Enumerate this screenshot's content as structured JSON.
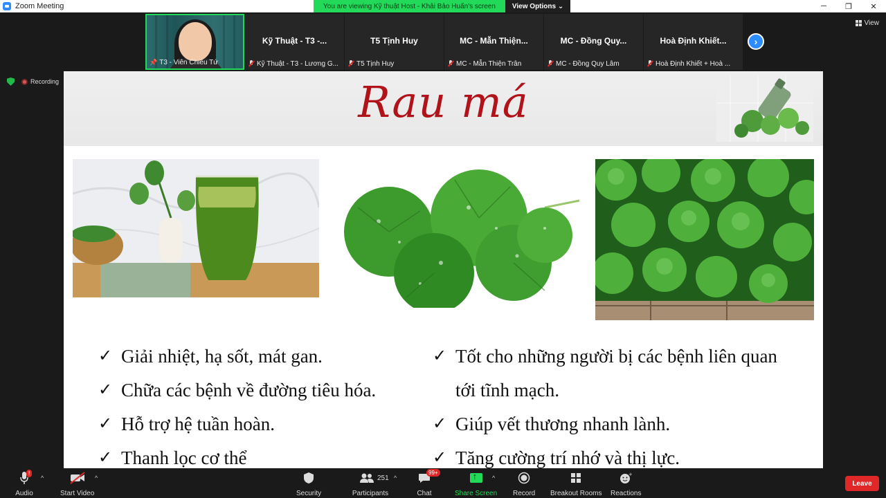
{
  "window": {
    "title": "Zoom Meeting",
    "controls": [
      "─",
      "❐",
      "✕"
    ]
  },
  "banner": {
    "message": "You are viewing Kỹ thuật Host - Khải Bảo Huấn's screen",
    "options_label": "View Options ⌄"
  },
  "participants_strip": [
    {
      "big_name": "",
      "sub_label": "T3 - Viên Chiêu Tứ",
      "has_video": true,
      "muted": false,
      "pinned": true
    },
    {
      "big_name": "Kỹ Thuật - T3 -...",
      "sub_label": "Kỹ Thuật - T3 - Lương G...",
      "has_video": false,
      "muted": true
    },
    {
      "big_name": "T5 Tịnh Huy",
      "sub_label": "T5 Tịnh Huy",
      "has_video": false,
      "muted": true
    },
    {
      "big_name": "MC - Mẫn Thiện...",
      "sub_label": "MC - Mẫn Thiện Trân",
      "has_video": false,
      "muted": true
    },
    {
      "big_name": "MC - Đồng Quy...",
      "sub_label": "MC - Đồng Quy Lâm",
      "has_video": false,
      "muted": true
    },
    {
      "big_name": "Hoà Định Khiết...",
      "sub_label": "Hoà Định Khiết + Hoà ...",
      "has_video": false,
      "muted": true
    }
  ],
  "view_button": {
    "label": "View"
  },
  "status": {
    "recording_label": "Recording"
  },
  "slide": {
    "title": "Rau má",
    "bullets_left": [
      "Giải nhiệt, hạ sốt, mát gan.",
      "Chữa các bệnh về đường tiêu hóa.",
      "Hỗ trợ hệ tuần hoàn.",
      "Thanh lọc cơ thể"
    ],
    "bullets_right": [
      {
        "text": "Tốt cho những người bị các bệnh liên quan",
        "check": true
      },
      {
        "text": "tới tĩnh mạch.",
        "check": false
      },
      {
        "text": "Giúp vết thương nhanh lành.",
        "check": true
      },
      {
        "text": "Tăng cường trí nhớ và thị lực.",
        "check": true
      }
    ],
    "check_glyph": "✓"
  },
  "toolbar": {
    "audio": "Audio",
    "audio_badge": "!",
    "video": "Start Video",
    "security": "Security",
    "participants": "Participants",
    "participants_count": "251",
    "chat": "Chat",
    "chat_badge": "99+",
    "share": "Share Screen",
    "record": "Record",
    "breakout": "Breakout Rooms",
    "reactions": "Reactions",
    "leave": "Leave"
  },
  "colors": {
    "accent_green": "#23d959",
    "brand_blue": "#2d8cff",
    "danger": "#e02828",
    "title_red": "#b0131a"
  }
}
